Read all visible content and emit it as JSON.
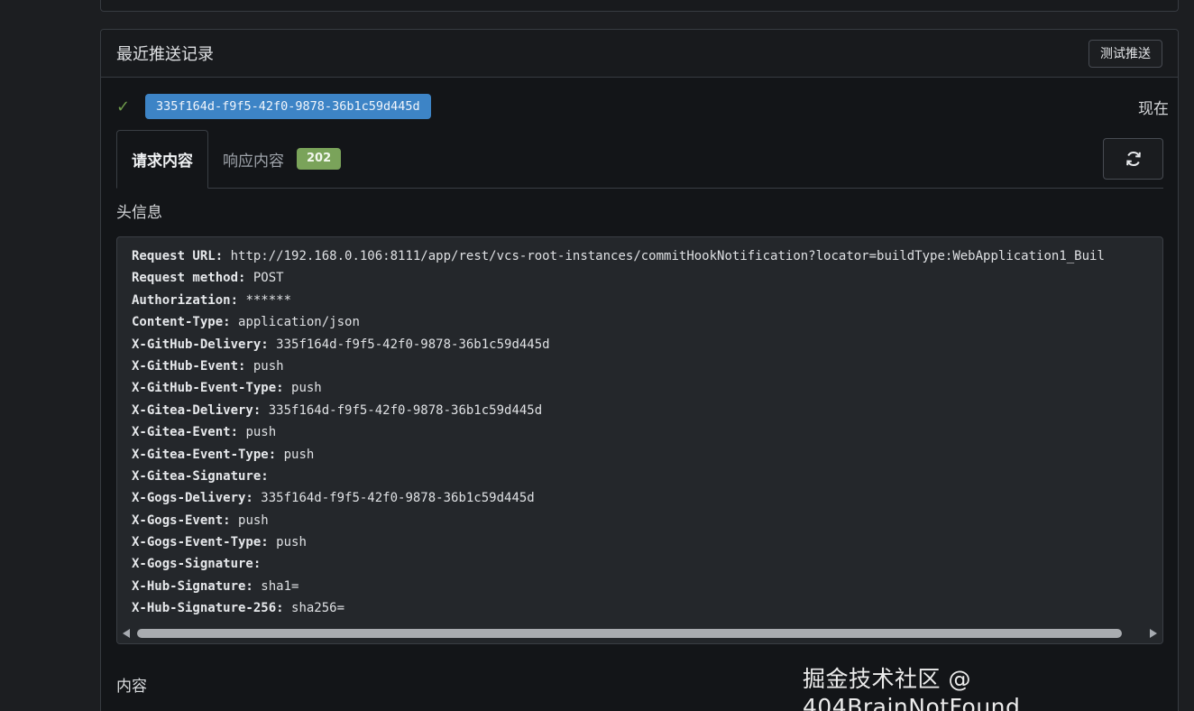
{
  "panel": {
    "title": "最近推送记录",
    "test_button": "测试推送"
  },
  "delivery": {
    "uuid": "335f164d-f9f5-42f0-9878-36b1c59d445d",
    "time": "现在"
  },
  "tabs": {
    "request": "请求内容",
    "response": "响应内容",
    "status_code": "202"
  },
  "headers_label": "头信息",
  "headers": [
    {
      "key": "Request URL:",
      "value": "http://192.168.0.106:8111/app/rest/vcs-root-instances/commitHookNotification?locator=buildType:WebApplication1_Buil"
    },
    {
      "key": "Request method:",
      "value": "POST"
    },
    {
      "key": "Authorization:",
      "value": "******"
    },
    {
      "key": "Content-Type:",
      "value": "application/json"
    },
    {
      "key": "X-GitHub-Delivery:",
      "value": "335f164d-f9f5-42f0-9878-36b1c59d445d"
    },
    {
      "key": "X-GitHub-Event:",
      "value": "push"
    },
    {
      "key": "X-GitHub-Event-Type:",
      "value": "push"
    },
    {
      "key": "X-Gitea-Delivery:",
      "value": "335f164d-f9f5-42f0-9878-36b1c59d445d"
    },
    {
      "key": "X-Gitea-Event:",
      "value": "push"
    },
    {
      "key": "X-Gitea-Event-Type:",
      "value": "push"
    },
    {
      "key": "X-Gitea-Signature:",
      "value": ""
    },
    {
      "key": "X-Gogs-Delivery:",
      "value": "335f164d-f9f5-42f0-9878-36b1c59d445d"
    },
    {
      "key": "X-Gogs-Event:",
      "value": "push"
    },
    {
      "key": "X-Gogs-Event-Type:",
      "value": "push"
    },
    {
      "key": "X-Gogs-Signature:",
      "value": ""
    },
    {
      "key": "X-Hub-Signature:",
      "value": "sha1="
    },
    {
      "key": "X-Hub-Signature-256:",
      "value": "sha256="
    }
  ],
  "content_label": "内容",
  "watermark": "掘金技术社区 @ 404BrainNotFound",
  "icons": {
    "success": "check-icon",
    "refresh": "refresh-icon"
  }
}
